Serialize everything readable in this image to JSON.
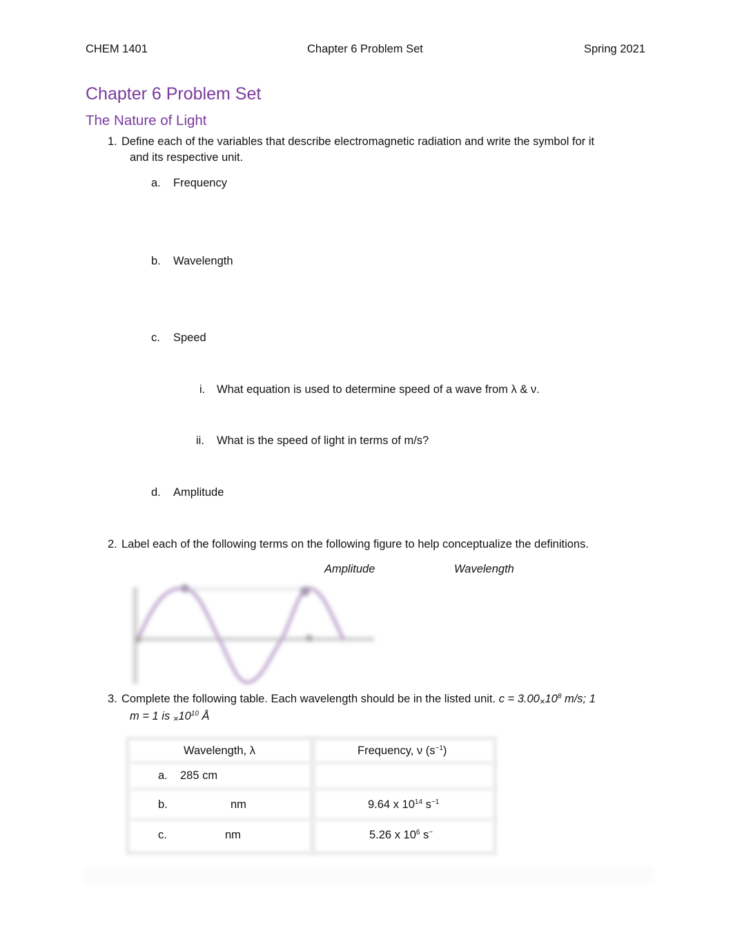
{
  "header": {
    "course": "CHEM 1401",
    "doc_title": "Chapter 6 Problem Set",
    "term": "Spring 2021"
  },
  "title": "Chapter 6 Problem Set",
  "section_heading": "The Nature of Light",
  "colors": {
    "heading": "#7a3a9e",
    "wave": "#b89ac8"
  },
  "q1": {
    "number": "1.",
    "line1": "Define each of the variables that describe electromagnetic radiation and write the symbol for it",
    "line2": "and its respective unit.",
    "items": [
      {
        "marker": "a.",
        "text": "Frequency"
      },
      {
        "marker": "b.",
        "text": "Wavelength"
      },
      {
        "marker": "c.",
        "text": "Speed"
      },
      {
        "marker": "d.",
        "text": "Amplitude"
      }
    ],
    "subitems": [
      {
        "marker": "i.",
        "text": "What equation is used to determine speed of a wave from λ & ν."
      },
      {
        "marker": "ii.",
        "text": "What is the speed of light in terms of m/s?"
      }
    ]
  },
  "q2": {
    "number": "2.",
    "text": "Label each of the following terms on the following figure to help conceptualize the definitions.",
    "terms": [
      "Amplitude",
      "Wavelength"
    ],
    "figure_icon": "sine-wave-figure"
  },
  "q3": {
    "number": "3.",
    "text": "Complete the following table. Each wavelength should be in the listed unit.",
    "c_pre": "c = 3.00",
    "times": "×",
    "c_base": "10",
    "c_exp": "8",
    "c_post": "m/s; 1",
    "line2_pre": "m = 1 is",
    "line2_base": "10",
    "line2_exp": "10",
    "line2_unit": "Å"
  },
  "table": {
    "headers": {
      "wavelength": "Wavelength, λ",
      "frequency_pre": "Frequency, ν (s",
      "frequency_exp": "−1",
      "frequency_post": ")"
    },
    "rows": [
      {
        "marker": "a.",
        "wavelength": "285 cm",
        "freq_mant": "",
        "freq_exp": "",
        "freq_unit": "",
        "freq_unit_exp": ""
      },
      {
        "marker": "b.",
        "wavelength": "nm",
        "freq_mant": "9.64 x 10",
        "freq_exp": "14",
        "freq_unit": " s",
        "freq_unit_exp": "−1"
      },
      {
        "marker": "c.",
        "wavelength": "nm",
        "freq_mant": "5.26 x 10",
        "freq_exp": "6",
        "freq_unit": " s",
        "freq_unit_exp": "−"
      }
    ]
  }
}
